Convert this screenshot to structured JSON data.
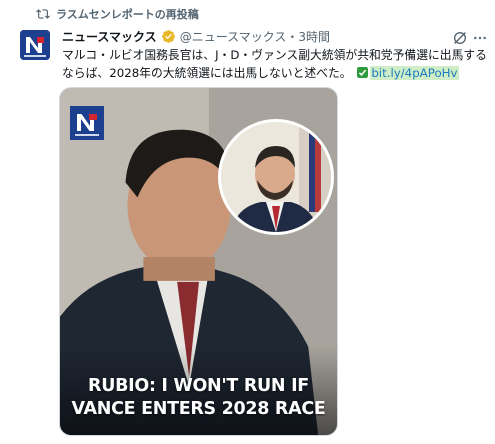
{
  "repost": {
    "label": "ラスムセンレポートの再投稿"
  },
  "post": {
    "display_name": "ニュースマックス",
    "handle_time": "@ニュースマックス・3時間",
    "text_main": "マルコ・ルビオ国務長官は、J・D・ヴァンス副大統領が共和党予備選に出馬するならば、2028年の大統領選には出馬しないと述べた。",
    "link_text": "bit.ly/4pAPoHv"
  },
  "media": {
    "headline_line1": "RUBIO: I WON'T RUN IF",
    "headline_line2": "VANCE ENTERS 2028 RACE",
    "logo_text": "NEWSMAX"
  },
  "colors": {
    "brand_blue": "#1d3f8f",
    "verified_gold": "#e8b829",
    "link_blue": "#1d7bc0",
    "link_highlight": "#cfeec7",
    "muted_text": "#536471"
  },
  "icons": [
    "repost-icon",
    "avatar-newsmax-logo",
    "verified-badge-icon",
    "grok-icon",
    "more-icon",
    "check-icon"
  ]
}
